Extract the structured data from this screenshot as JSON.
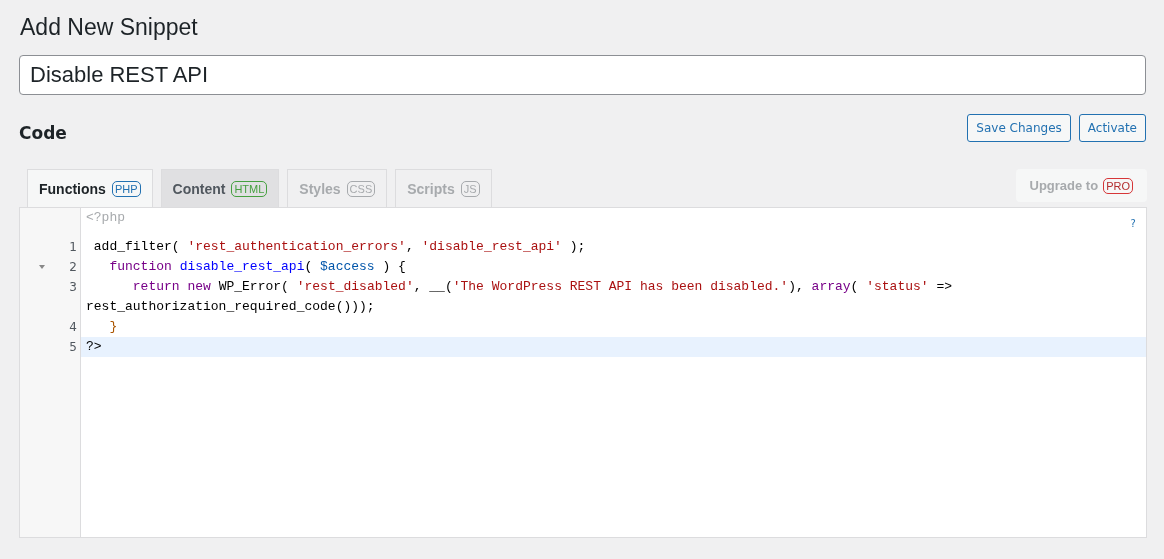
{
  "page_title": "Add New Snippet",
  "snippet_title": {
    "value": "Disable REST API"
  },
  "section_label": "Code",
  "buttons": [
    "Save Changes",
    "Activate"
  ],
  "tabs": [
    {
      "label": "Functions",
      "badge": "PHP",
      "color": "#2271b1",
      "selected": true,
      "disabled": false
    },
    {
      "label": "Content",
      "badge": "HTML",
      "color": "#46a040",
      "selected": false,
      "disabled": false
    },
    {
      "label": "Styles",
      "badge": "CSS",
      "color": "#a7aaad",
      "selected": false,
      "disabled": true
    },
    {
      "label": "Scripts",
      "badge": "JS",
      "color": "#a7aaad",
      "selected": false,
      "disabled": true
    }
  ],
  "upgrade": {
    "label": "Upgrade to",
    "badge": "PRO"
  },
  "editor": {
    "header": "<?php",
    "help": "?",
    "lines": [
      {
        "number": "1",
        "foldable": false,
        "active": false,
        "tokens": [
          {
            "kind": "plain",
            "text": " add_filter( "
          },
          {
            "kind": "string",
            "text": "'rest_authentication_errors'"
          },
          {
            "kind": "plain",
            "text": ", "
          },
          {
            "kind": "string",
            "text": "'disable_rest_api'"
          },
          {
            "kind": "plain",
            "text": " );"
          }
        ]
      },
      {
        "number": "2",
        "foldable": true,
        "active": false,
        "tokens": [
          {
            "kind": "keyword",
            "text": "   function"
          },
          {
            "kind": "def",
            "text": " disable_rest_api"
          },
          {
            "kind": "plain",
            "text": "( "
          },
          {
            "kind": "variable",
            "text": "$access"
          },
          {
            "kind": "plain",
            "text": " ) {"
          }
        ]
      },
      {
        "number": "3",
        "foldable": false,
        "active": false,
        "tokens": [
          {
            "kind": "keyword",
            "text": "      return"
          },
          {
            "kind": "keyword",
            "text": " new"
          },
          {
            "kind": "plain",
            "text": " WP_Error( "
          },
          {
            "kind": "string",
            "text": "'rest_disabled'"
          },
          {
            "kind": "plain",
            "text": ", __("
          },
          {
            "kind": "string",
            "text": "'The WordPress REST API has been disabled.'"
          },
          {
            "kind": "plain",
            "text": "), "
          },
          {
            "kind": "keyword",
            "text": "array"
          },
          {
            "kind": "plain",
            "text": "( "
          },
          {
            "kind": "string",
            "text": "'status'"
          },
          {
            "kind": "plain",
            "text": " => rest_authorization_required_code()));"
          }
        ]
      },
      {
        "number": "4",
        "foldable": false,
        "active": false,
        "tokens": [
          {
            "kind": "bracket",
            "text": "   }"
          }
        ]
      },
      {
        "number": "5",
        "foldable": false,
        "active": true,
        "tokens": [
          {
            "kind": "plain",
            "text": "?>"
          }
        ]
      }
    ]
  }
}
